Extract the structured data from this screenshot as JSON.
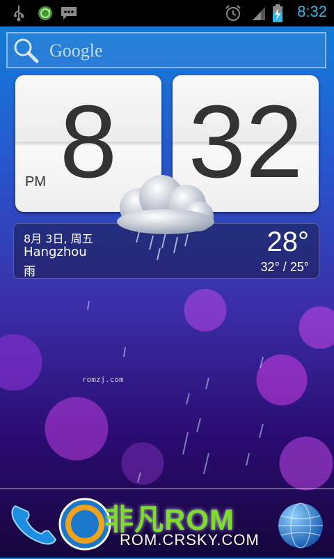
{
  "status_bar": {
    "time": "8:32",
    "icons_left": [
      "usb-icon",
      "sync-icon",
      "message-icon"
    ],
    "icons_right": [
      "alarm-icon",
      "signal-icon",
      "battery-charging-icon"
    ],
    "accent_color": "#33b5e5"
  },
  "search_bar": {
    "label": "Google"
  },
  "clock": {
    "hour": "8",
    "minute": "32",
    "ampm": "PM"
  },
  "weather": {
    "date": "8月 3日, 周五",
    "city": "Hangzhou",
    "condition": "雨",
    "temperature": "28°",
    "range": "32° / 25°"
  },
  "watermark": {
    "text": "romzj.com"
  },
  "dock": {
    "brand": "非凡ROM",
    "brand_url": "ROM.CRSKY.COM"
  }
}
